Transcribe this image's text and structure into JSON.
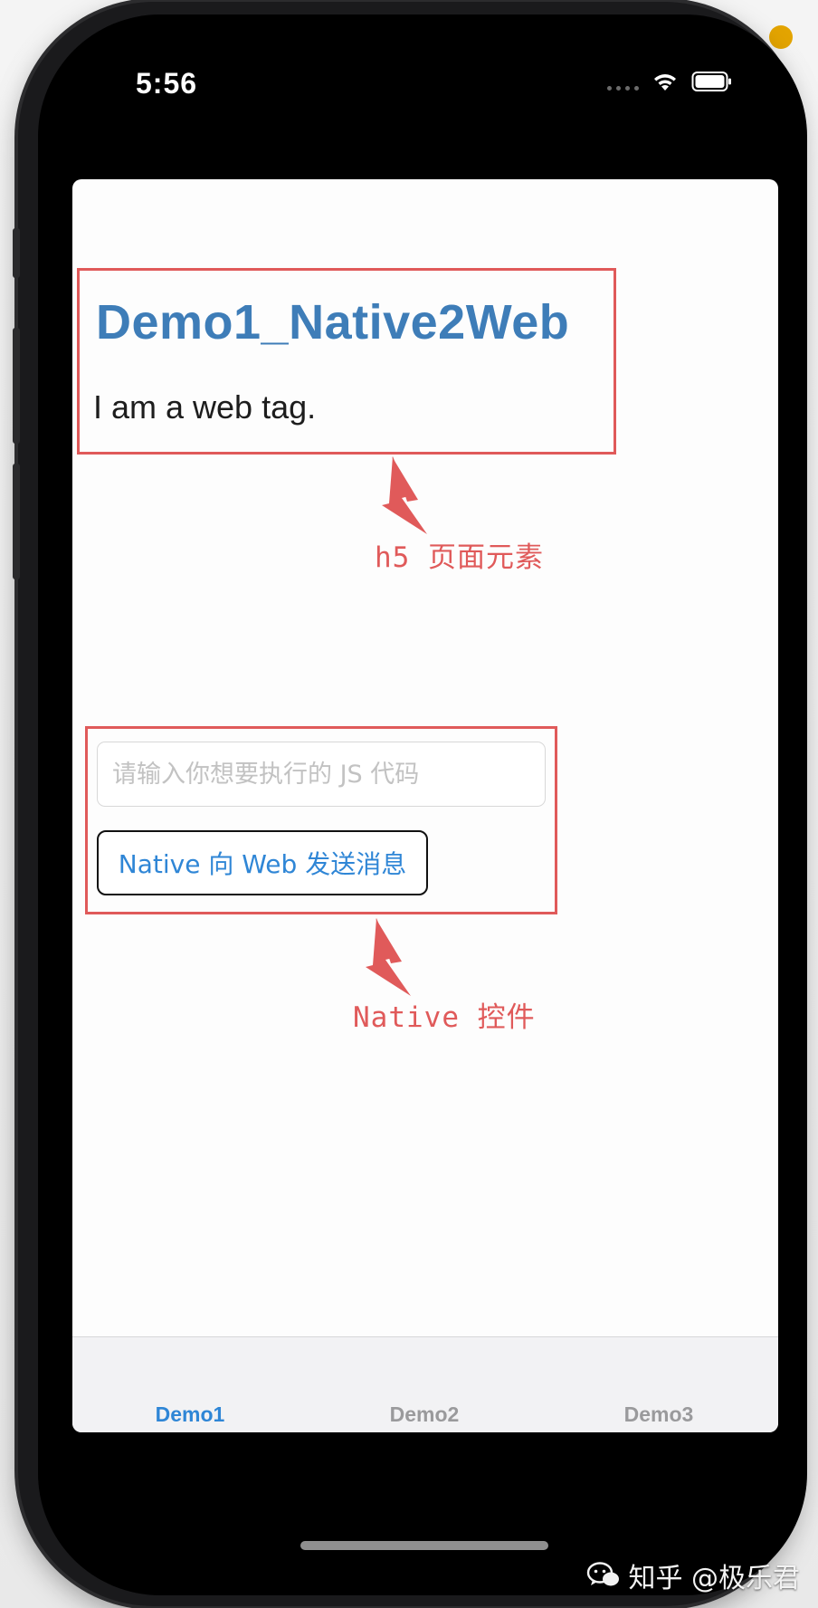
{
  "status_bar": {
    "time": "5:56"
  },
  "web": {
    "title": "Demo1_Native2Web",
    "text": "I am a web tag."
  },
  "annotations": {
    "h5_label": "h5 页面元素",
    "native_label": "Native 控件"
  },
  "native": {
    "input_placeholder": "请输入你想要执行的 JS 代码",
    "input_value": "",
    "send_button": "Native 向 Web 发送消息"
  },
  "tabs": [
    {
      "label": "Demo1",
      "active": true
    },
    {
      "label": "Demo2",
      "active": false
    },
    {
      "label": "Demo3",
      "active": false
    }
  ],
  "watermark": {
    "text": "知乎 @极乐君"
  },
  "colors": {
    "annotation_red": "#e05a5a",
    "web_title_blue": "#3e7db8",
    "tab_active_blue": "#2f86d6",
    "tab_inactive_gray": "#9a9a9c"
  },
  "icons": [
    "cellular-signal-icon",
    "wifi-icon",
    "battery-icon",
    "arrow-up-icon",
    "wechat-logo-icon"
  ]
}
